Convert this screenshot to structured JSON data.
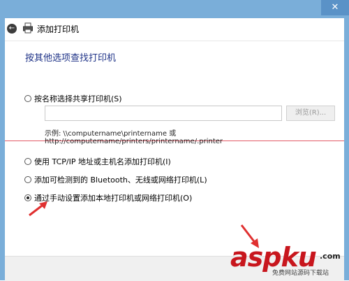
{
  "window": {
    "close_glyph": "✕"
  },
  "header": {
    "title": "添加打印机",
    "back_glyph": "←"
  },
  "main": {
    "title": "按其他选项查找打印机",
    "options": [
      {
        "label": "按名称选择共享打印机(S)",
        "checked": false
      },
      {
        "label": "使用 TCP/IP 地址或主机名添加打印机(I)",
        "checked": false
      },
      {
        "label": "添加可检测到的 Bluetooth、无线或网络打印机(L)",
        "checked": false
      },
      {
        "label": "通过手动设置添加本地打印机或网络打印机(O)",
        "checked": true
      }
    ],
    "name_input": {
      "value": "",
      "placeholder": ""
    },
    "browse_label": "浏览(R)...",
    "example_line1": "示例: \\\\computername\\printername 或",
    "example_line2": "http://computername/printers/printername/.printer"
  },
  "watermark": {
    "main": "aspku",
    "tld": ".com",
    "sub": "免费网站源码下载站"
  },
  "colors": {
    "titlebar": "#7aaed9",
    "title_text": "#1e3287",
    "annotation": "#e03030",
    "watermark": "#c8161d"
  }
}
